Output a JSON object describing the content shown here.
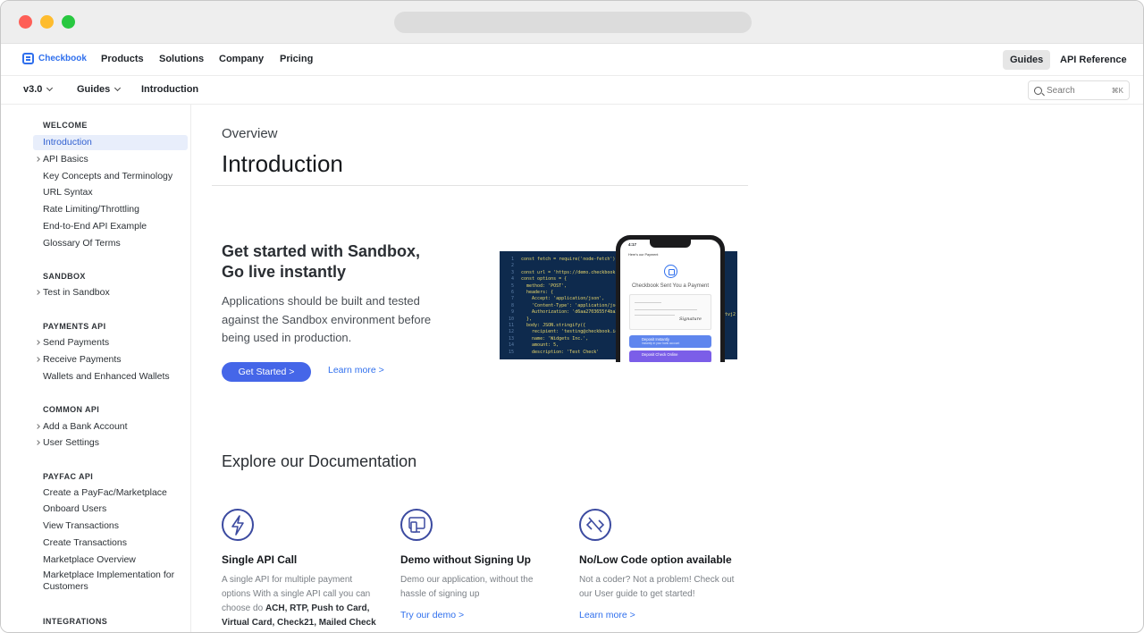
{
  "topnav": {
    "logo_text": "Checkbook",
    "links": [
      "Products",
      "Solutions",
      "Company",
      "Pricing"
    ],
    "guides_label": "Guides",
    "api_reference_label": "API Reference"
  },
  "subnav": {
    "version": "v3.0",
    "guides": "Guides",
    "page": "Introduction",
    "search_placeholder": "Search",
    "search_shortcut": "⌘K"
  },
  "sidebar": {
    "sections": [
      {
        "title": "WELCOME",
        "items": [
          {
            "label": "Introduction",
            "active": true,
            "expandable": false
          },
          {
            "label": "API Basics",
            "expandable": true
          },
          {
            "label": "Key Concepts and Terminology"
          },
          {
            "label": "URL Syntax"
          },
          {
            "label": "Rate Limiting/Throttling"
          },
          {
            "label": "End-to-End API Example"
          },
          {
            "label": "Glossary Of Terms"
          }
        ]
      },
      {
        "title": "SANDBOX",
        "items": [
          {
            "label": "Test in Sandbox",
            "expandable": true
          }
        ]
      },
      {
        "title": "PAYMENTS API",
        "items": [
          {
            "label": "Send Payments",
            "expandable": true
          },
          {
            "label": "Receive Payments",
            "expandable": true
          },
          {
            "label": "Wallets and Enhanced Wallets"
          }
        ]
      },
      {
        "title": "COMMON API",
        "items": [
          {
            "label": "Add a Bank Account",
            "expandable": true
          },
          {
            "label": "User Settings",
            "expandable": true
          }
        ]
      },
      {
        "title": "PAYFAC API",
        "items": [
          {
            "label": "Create a PayFac/Marketplace"
          },
          {
            "label": "Onboard Users"
          },
          {
            "label": "View Transactions"
          },
          {
            "label": "Create Transactions"
          },
          {
            "label": "Marketplace Overview"
          },
          {
            "label": "Marketplace Implementation for Customers"
          }
        ]
      },
      {
        "title": "INTEGRATIONS",
        "items": []
      }
    ]
  },
  "main": {
    "crumb": "Overview",
    "title": "Introduction",
    "hero": {
      "title_line1": "Get started with Sandbox,",
      "title_line2": "Go live instantly",
      "text": "Applications should be built and tested against the Sandbox environment before being used in production.",
      "button": "Get Started >",
      "link": "Learn more >"
    },
    "code": {
      "lines": [
        "const fetch = require('node-fetch');",
        "",
        "const url = 'https://demo.checkbook.",
        "const options = {",
        "  method: 'POST',",
        "  headers: {",
        "    Accept: 'application/json',",
        "    'Content-Type': 'application/json",
        "    Authorization: 'd6aa2703655f4ba2",
        "  },",
        "  body: JSON.stringify({",
        "    recipient: 'testing@checkbook.io'",
        "    name: 'Widgets Inc.',",
        "    amount: 5,",
        "    description: 'Test Check'"
      ],
      "trail": "rtvj2"
    },
    "phone": {
      "time": "4:17",
      "header": "Here's our Payment",
      "title": "Checkbook Sent You a Payment",
      "signature": "Signature",
      "btn1": "Deposit Instantly",
      "btn1_sub": "Instantly in your bank account",
      "btn2": "Deposit Check Online"
    },
    "explore_title": "Explore our Documentation",
    "cards": [
      {
        "icon": "lightning-icon",
        "title": "Single API Call",
        "text_plain": "A single API for multiple payment options With a single API call you can choose do ",
        "text_bold": "ACH, RTP, Push to Card, Virtual Card, Check21, Mailed Check",
        "link": ""
      },
      {
        "icon": "monitor-phone-icon",
        "title": "Demo without Signing Up",
        "text": "Demo our application, without the hassle of signing up",
        "link": "Try our demo >"
      },
      {
        "icon": "no-code-icon",
        "title": "No/Low Code option available",
        "text": "Not a coder? Not a problem! Check out our User guide to get started!",
        "link": "Learn more >"
      }
    ]
  },
  "colors": {
    "accent": "#2f6fed",
    "button": "#4566e8",
    "active_bg": "#e8eefb",
    "icon_stroke": "#3b4aa0"
  }
}
